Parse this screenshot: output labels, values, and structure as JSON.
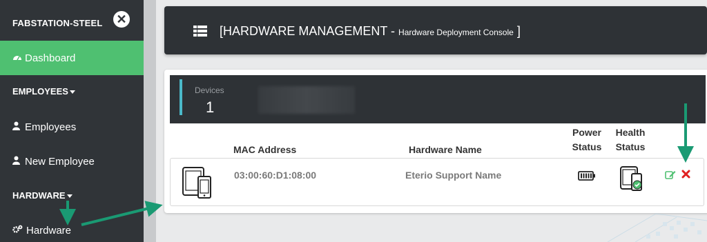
{
  "sidebar": {
    "brand": "FABSTATION-STEEL",
    "close_icon": "close-circle-icon",
    "dashboard": {
      "label": "Dashboard",
      "icon": "dashboard-icon"
    },
    "employees_section": "EMPLOYEES",
    "employees": {
      "label": "Employees",
      "icon": "user-icon"
    },
    "new_employee": {
      "label": "New Employee",
      "icon": "user-icon"
    },
    "hardware_section": "HARDWARE",
    "hardware": {
      "label": "Hardware",
      "icon": "cogs-icon"
    }
  },
  "header": {
    "open_bracket": "[",
    "title": "HARDWARE MANAGEMENT -",
    "subtitle": "Hardware Deployment Console",
    "close_bracket": "]"
  },
  "summary": {
    "label": "Devices",
    "count": "1"
  },
  "table": {
    "columns": {
      "mac": "MAC Address",
      "name": "Hardware Name",
      "power_line1": "Power",
      "power_line2": "Status",
      "health_line1": "Health",
      "health_line2": "Status"
    },
    "rows": [
      {
        "icon": "devices-icon",
        "mac": "03:00:60:D1:08:00",
        "name": "Eterio Support Name",
        "power_icon": "battery-full-icon",
        "health_icon": "device-health-check-icon",
        "edit_icon": "edit-icon",
        "delete_icon": "delete-icon"
      }
    ]
  },
  "colors": {
    "sidebar_bg": "#303438",
    "active_green": "#4fc071",
    "header_bg": "#2e3236",
    "accent_teal": "#4bb9c9",
    "arrow_teal": "#1a9a73",
    "delete_red": "#e02020"
  }
}
